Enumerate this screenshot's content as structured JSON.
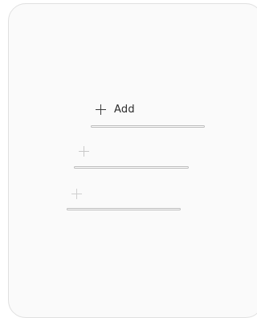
{
  "panel": {
    "items": [
      {
        "label": "Add",
        "icon": "plus-icon",
        "state": "active"
      },
      {
        "label": "",
        "icon": "plus-icon",
        "state": "faded"
      },
      {
        "label": "",
        "icon": "plus-icon",
        "state": "faded"
      }
    ]
  },
  "colors": {
    "card_background": "#fafafa",
    "card_border": "#e0e0e0",
    "active_text": "#2b2b2b",
    "faded_icon": "#c9c9c9",
    "underline_border": "#bdbdbd"
  }
}
